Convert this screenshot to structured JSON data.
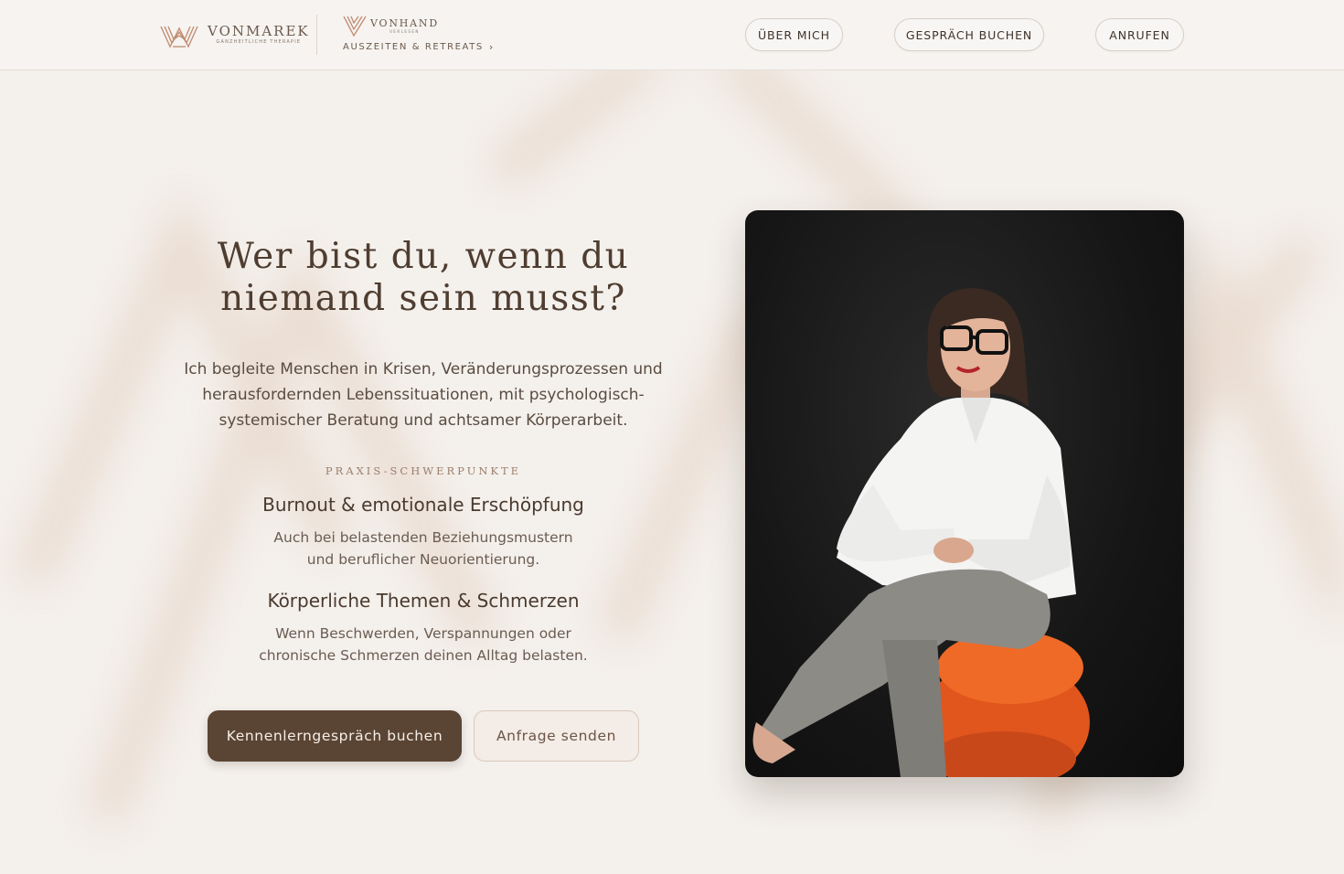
{
  "brand": {
    "primary_name": "VONMAREK",
    "primary_tagline": "GANZHEITLICHE THERAPIE",
    "secondary_name": "VONHAND",
    "secondary_tagline": "VERLESEN",
    "secondary_link": "AUSZEITEN & RETREATS",
    "accent_color": "#b8866a"
  },
  "nav": {
    "about": "ÜBER MICH",
    "book": "GESPRÄCH BUCHEN",
    "call": "ANRUFEN"
  },
  "hero": {
    "title_line1": "Wer bist du, wenn du",
    "title_line2": "niemand sein musst?",
    "lead_line1": "Ich begleite Menschen in Krisen, Veränderungsprozessen und",
    "lead_line2": "herausfordernden Lebenssituationen, mit psychologisch-",
    "lead_line3": "systemischer Beratung und achtsamer Körperarbeit.",
    "eyebrow": "PRAXIS-SCHWERPUNKTE",
    "focus": [
      {
        "title": "Burnout & emotionale Erschöpfung",
        "text_line1": "Auch bei belastenden Beziehungsmustern",
        "text_line2": "und beruflicher Neuorientierung."
      },
      {
        "title": "Körperliche Themen & Schmerzen",
        "text_line1": "Wenn Beschwerden, Verspannungen oder",
        "text_line2": "chronische Schmerzen deinen Alltag belasten."
      }
    ],
    "cta_primary": "Kennenlerngespräch buchen",
    "cta_secondary": "Anfrage senden"
  },
  "colors": {
    "background": "#f4f0ec",
    "primary_button": "#5a4434",
    "heading": "#4e3d30"
  },
  "icons": {
    "brand_mark": "vonmarek-logo-icon",
    "secondary_mark": "vonhand-logo-icon",
    "link_chevron": "chevron-right-icon"
  }
}
